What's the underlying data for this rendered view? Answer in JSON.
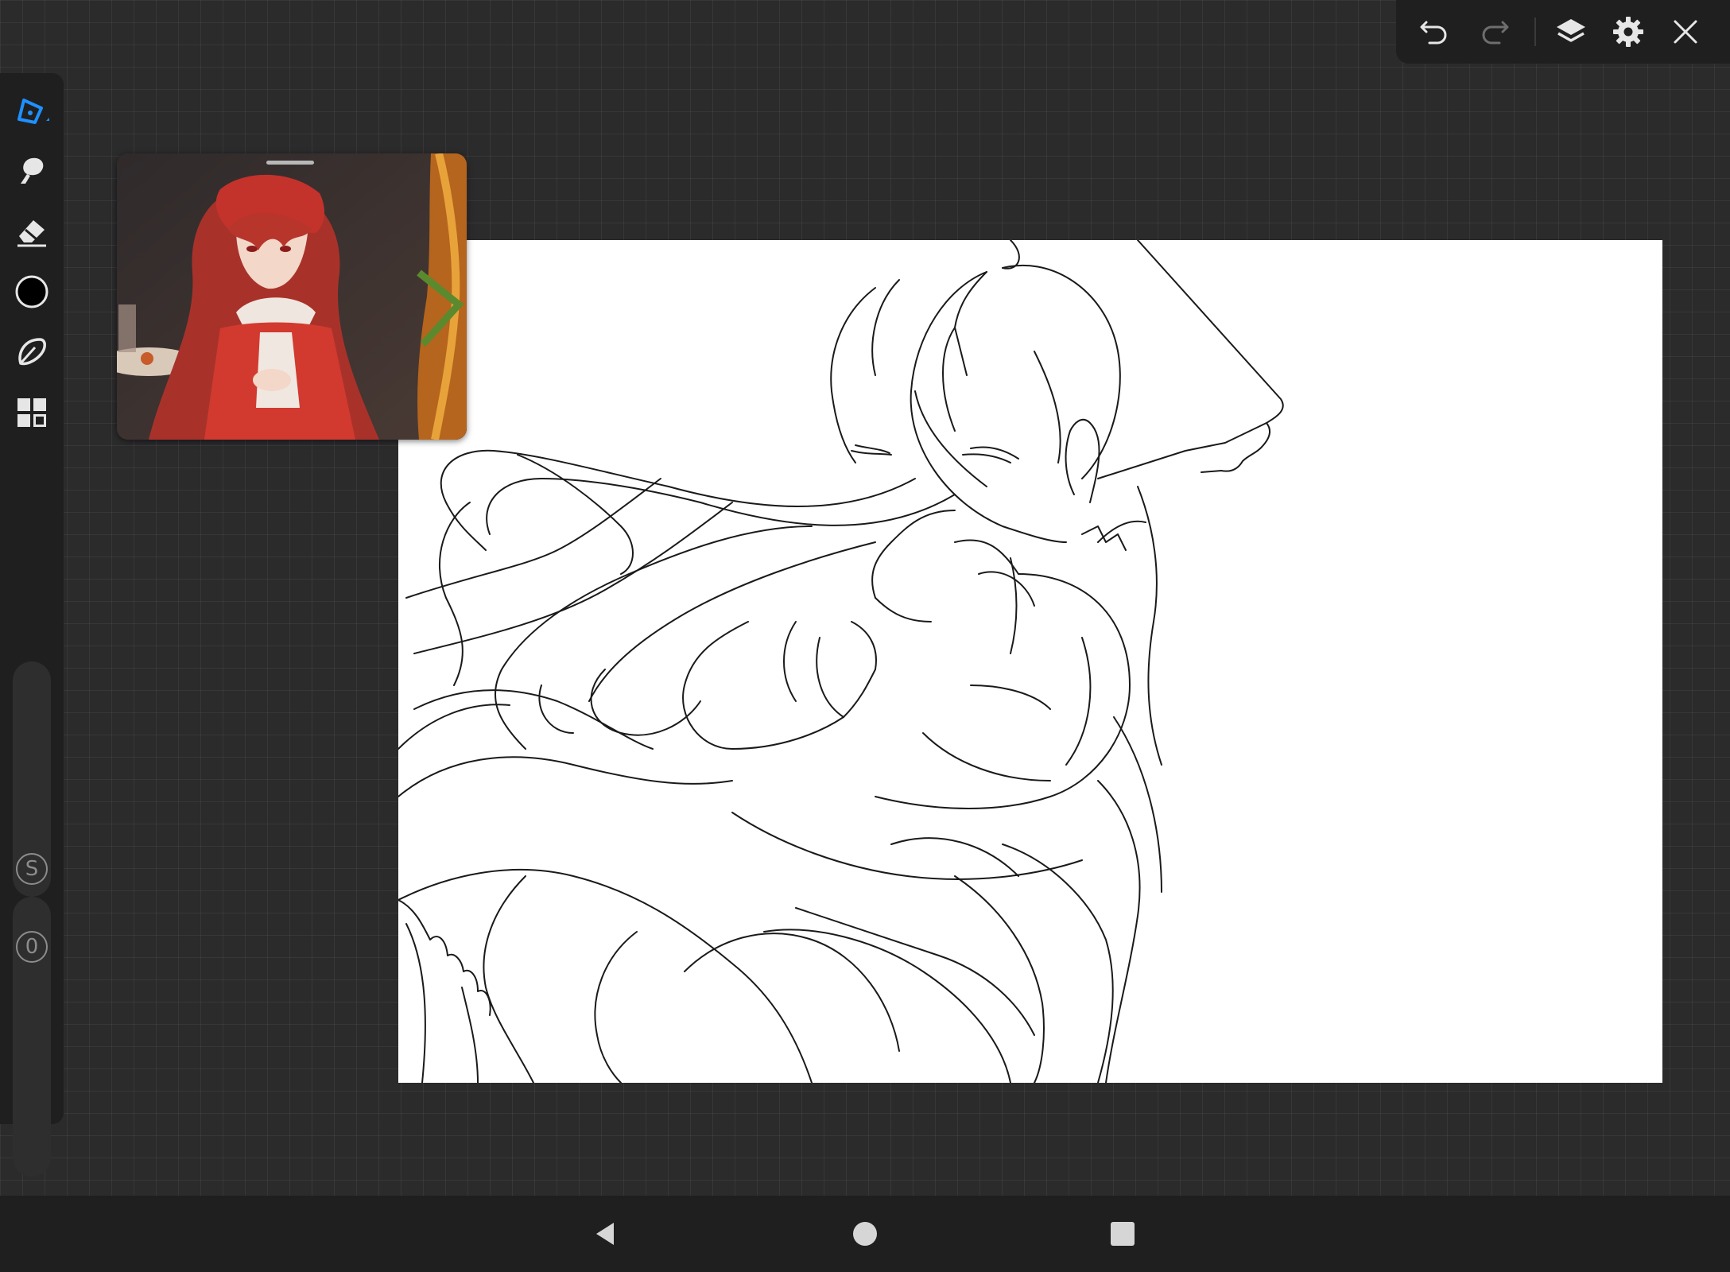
{
  "app": {
    "name": "drawing-app",
    "accent_color": "#1e90ff",
    "background_color": "#2b2b2c",
    "panel_color": "#1f1f1f"
  },
  "top_toolbar": {
    "buttons": [
      {
        "id": "undo",
        "icon": "undo-icon"
      },
      {
        "id": "redo",
        "icon": "redo-icon",
        "state": "disabled"
      },
      {
        "id": "layers",
        "icon": "layers-icon"
      },
      {
        "id": "settings",
        "icon": "gear-icon"
      },
      {
        "id": "close",
        "icon": "close-icon"
      }
    ]
  },
  "tool_rail": {
    "tools": [
      {
        "id": "pen",
        "icon": "pen-icon",
        "active": true
      },
      {
        "id": "smudge",
        "icon": "smudge-icon"
      },
      {
        "id": "eraser",
        "icon": "eraser-icon"
      },
      {
        "id": "color",
        "icon": "color-swatch",
        "color": "#000000"
      },
      {
        "id": "lasso",
        "icon": "lasso-icon"
      },
      {
        "id": "gallery",
        "icon": "gallery-grid-icon"
      }
    ],
    "size_slider": {
      "label": "S"
    },
    "opacity_slider": {
      "label": "0"
    }
  },
  "reference_window": {
    "image": "reference-illustration-red-haired-girl",
    "colors": {
      "hair": "#c0392b",
      "background": "#3a2f2c"
    }
  },
  "canvas": {
    "background": "#ffffff",
    "content": "line-art-sketch"
  },
  "nav_bar": {
    "buttons": [
      {
        "id": "back",
        "icon": "back-triangle-icon"
      },
      {
        "id": "home",
        "icon": "home-circle-icon"
      },
      {
        "id": "recents",
        "icon": "recents-square-icon"
      }
    ]
  }
}
